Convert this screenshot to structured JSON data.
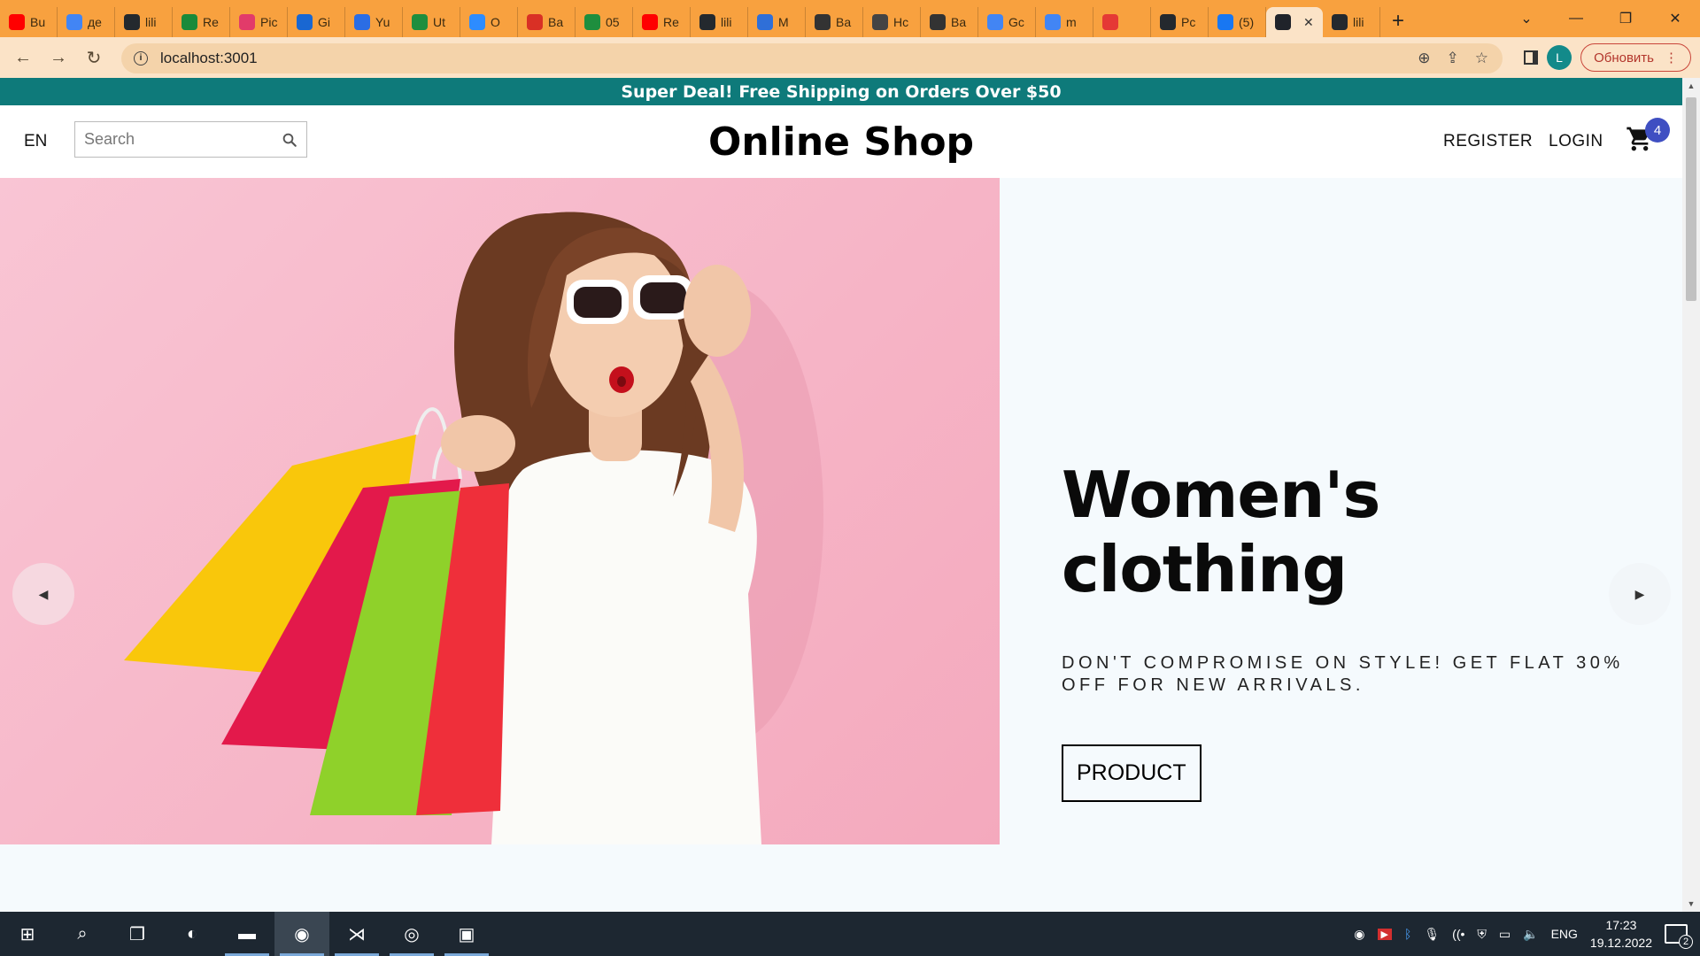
{
  "browser": {
    "tabs": [
      {
        "label": "Bu",
        "icon": "youtube-icon",
        "color": "#ff0000"
      },
      {
        "label": "де",
        "icon": "google-icon",
        "color": "#4285f4"
      },
      {
        "label": "lili",
        "icon": "github-icon",
        "color": "#24292e"
      },
      {
        "label": "Re",
        "icon": "wordpress-icon",
        "color": "#1a8a3a"
      },
      {
        "label": "Pic",
        "icon": "pictory-icon",
        "color": "#e23b6a"
      },
      {
        "label": "Gi",
        "icon": "drive-icon",
        "color": "#1967d2"
      },
      {
        "label": "Yu",
        "icon": "z-icon",
        "color": "#2b6de4"
      },
      {
        "label": "Ut",
        "icon": "plus-icon",
        "color": "#1e8e3e"
      },
      {
        "label": "O",
        "icon": "zoom-icon",
        "color": "#2d8cff"
      },
      {
        "label": "Ba",
        "icon": "gmail-icon",
        "color": "#d93025"
      },
      {
        "label": "05",
        "icon": "plus-icon",
        "color": "#1e8e3e"
      },
      {
        "label": "Re",
        "icon": "youtube-icon",
        "color": "#ff0000"
      },
      {
        "label": "lili",
        "icon": "github-icon",
        "color": "#24292e"
      },
      {
        "label": "M",
        "icon": "m-icon",
        "color": "#2f6fd8"
      },
      {
        "label": "Ba",
        "icon": "markdown-icon",
        "color": "#333333"
      },
      {
        "label": "Hc",
        "icon": "chrome-icon",
        "color": "#444444"
      },
      {
        "label": "Ba",
        "icon": "markdown-icon",
        "color": "#333333"
      },
      {
        "label": "Gc",
        "icon": "translate-icon",
        "color": "#4285f4"
      },
      {
        "label": "m",
        "icon": "google-icon",
        "color": "#4285f4"
      },
      {
        "label": "",
        "icon": "recording-icon",
        "color": "#e53935"
      },
      {
        "label": "Pc",
        "icon": "github-icon",
        "color": "#24292e"
      },
      {
        "label": "(5)",
        "icon": "facebook-icon",
        "color": "#1877f2"
      },
      {
        "label": "",
        "icon": "react-icon",
        "color": "#20232a",
        "active": true
      },
      {
        "label": "lili",
        "icon": "github-icon",
        "color": "#24292e"
      }
    ],
    "new_tab": "+",
    "window_controls": {
      "minimize": "—",
      "restore": "❐",
      "close": "✕",
      "tab_search": "⌄"
    },
    "url": "localhost:3001",
    "profile_initial": "L",
    "update_label": "Обновить",
    "nav": {
      "back": "←",
      "forward": "→",
      "reload": "↻"
    }
  },
  "page": {
    "announcement": "Super Deal! Free Shipping on Orders Over $50",
    "nav": {
      "language": "EN",
      "search_placeholder": "Search",
      "brand": "Online Shop",
      "register": "REGISTER",
      "login": "LOGIN",
      "cart_count": "4"
    },
    "slide": {
      "title": "Women's clothing",
      "description": "DON'T COMPROMISE ON STYLE! GET FLAT 30% OFF FOR NEW ARRIVALS.",
      "button": "PRODUCT",
      "image_bg": "#f7bccb"
    }
  },
  "taskbar": {
    "apps": [
      {
        "name": "start-icon",
        "running": false
      },
      {
        "name": "search-icon",
        "running": false
      },
      {
        "name": "task-view-icon",
        "running": false
      },
      {
        "name": "edge-icon",
        "running": false
      },
      {
        "name": "file-explorer-icon",
        "running": true
      },
      {
        "name": "chrome-icon",
        "running": true,
        "active": true
      },
      {
        "name": "vscode-icon",
        "running": true
      },
      {
        "name": "discord-icon",
        "running": true
      },
      {
        "name": "terminal-icon",
        "running": true
      }
    ],
    "language": "ENG",
    "time": "17:23",
    "date": "19.12.2022",
    "notification_count": "2"
  },
  "colors": {
    "tabbar": "#f8a13f",
    "addressbar": "#fbe3c7",
    "announcement": "#0e7a7a",
    "cart_badge": "#3f4fc2",
    "taskbar": "#1d2731"
  }
}
